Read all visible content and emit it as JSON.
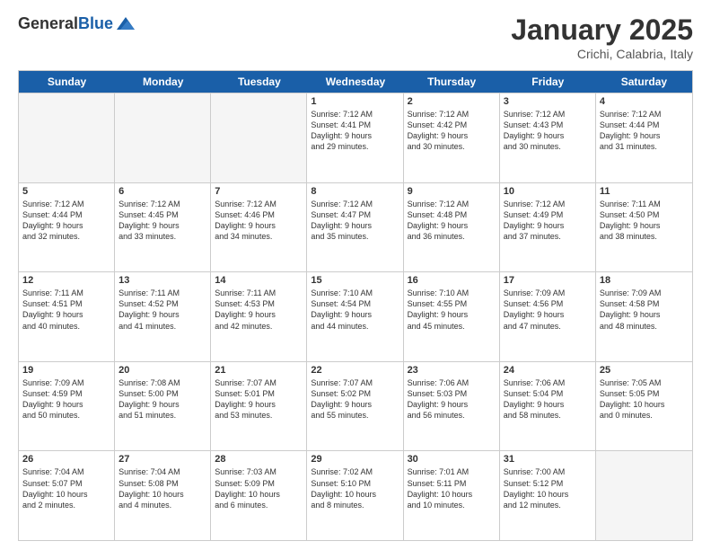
{
  "header": {
    "logo_general": "General",
    "logo_blue": "Blue",
    "month": "January 2025",
    "location": "Crichi, Calabria, Italy"
  },
  "weekdays": [
    "Sunday",
    "Monday",
    "Tuesday",
    "Wednesday",
    "Thursday",
    "Friday",
    "Saturday"
  ],
  "weeks": [
    [
      {
        "day": "",
        "empty": true
      },
      {
        "day": "",
        "empty": true
      },
      {
        "day": "",
        "empty": true
      },
      {
        "day": "1",
        "sunrise": "7:12 AM",
        "sunset": "4:41 PM",
        "daylight": "9 hours and 29 minutes."
      },
      {
        "day": "2",
        "sunrise": "7:12 AM",
        "sunset": "4:42 PM",
        "daylight": "9 hours and 30 minutes."
      },
      {
        "day": "3",
        "sunrise": "7:12 AM",
        "sunset": "4:43 PM",
        "daylight": "9 hours and 30 minutes."
      },
      {
        "day": "4",
        "sunrise": "7:12 AM",
        "sunset": "4:44 PM",
        "daylight": "9 hours and 31 minutes."
      }
    ],
    [
      {
        "day": "5",
        "sunrise": "7:12 AM",
        "sunset": "4:44 PM",
        "daylight": "9 hours and 32 minutes."
      },
      {
        "day": "6",
        "sunrise": "7:12 AM",
        "sunset": "4:45 PM",
        "daylight": "9 hours and 33 minutes."
      },
      {
        "day": "7",
        "sunrise": "7:12 AM",
        "sunset": "4:46 PM",
        "daylight": "9 hours and 34 minutes."
      },
      {
        "day": "8",
        "sunrise": "7:12 AM",
        "sunset": "4:47 PM",
        "daylight": "9 hours and 35 minutes."
      },
      {
        "day": "9",
        "sunrise": "7:12 AM",
        "sunset": "4:48 PM",
        "daylight": "9 hours and 36 minutes."
      },
      {
        "day": "10",
        "sunrise": "7:12 AM",
        "sunset": "4:49 PM",
        "daylight": "9 hours and 37 minutes."
      },
      {
        "day": "11",
        "sunrise": "7:11 AM",
        "sunset": "4:50 PM",
        "daylight": "9 hours and 38 minutes."
      }
    ],
    [
      {
        "day": "12",
        "sunrise": "7:11 AM",
        "sunset": "4:51 PM",
        "daylight": "9 hours and 40 minutes."
      },
      {
        "day": "13",
        "sunrise": "7:11 AM",
        "sunset": "4:52 PM",
        "daylight": "9 hours and 41 minutes."
      },
      {
        "day": "14",
        "sunrise": "7:11 AM",
        "sunset": "4:53 PM",
        "daylight": "9 hours and 42 minutes."
      },
      {
        "day": "15",
        "sunrise": "7:10 AM",
        "sunset": "4:54 PM",
        "daylight": "9 hours and 44 minutes."
      },
      {
        "day": "16",
        "sunrise": "7:10 AM",
        "sunset": "4:55 PM",
        "daylight": "9 hours and 45 minutes."
      },
      {
        "day": "17",
        "sunrise": "7:09 AM",
        "sunset": "4:56 PM",
        "daylight": "9 hours and 47 minutes."
      },
      {
        "day": "18",
        "sunrise": "7:09 AM",
        "sunset": "4:58 PM",
        "daylight": "9 hours and 48 minutes."
      }
    ],
    [
      {
        "day": "19",
        "sunrise": "7:09 AM",
        "sunset": "4:59 PM",
        "daylight": "9 hours and 50 minutes."
      },
      {
        "day": "20",
        "sunrise": "7:08 AM",
        "sunset": "5:00 PM",
        "daylight": "9 hours and 51 minutes."
      },
      {
        "day": "21",
        "sunrise": "7:07 AM",
        "sunset": "5:01 PM",
        "daylight": "9 hours and 53 minutes."
      },
      {
        "day": "22",
        "sunrise": "7:07 AM",
        "sunset": "5:02 PM",
        "daylight": "9 hours and 55 minutes."
      },
      {
        "day": "23",
        "sunrise": "7:06 AM",
        "sunset": "5:03 PM",
        "daylight": "9 hours and 56 minutes."
      },
      {
        "day": "24",
        "sunrise": "7:06 AM",
        "sunset": "5:04 PM",
        "daylight": "9 hours and 58 minutes."
      },
      {
        "day": "25",
        "sunrise": "7:05 AM",
        "sunset": "5:05 PM",
        "daylight": "10 hours and 0 minutes."
      }
    ],
    [
      {
        "day": "26",
        "sunrise": "7:04 AM",
        "sunset": "5:07 PM",
        "daylight": "10 hours and 2 minutes."
      },
      {
        "day": "27",
        "sunrise": "7:04 AM",
        "sunset": "5:08 PM",
        "daylight": "10 hours and 4 minutes."
      },
      {
        "day": "28",
        "sunrise": "7:03 AM",
        "sunset": "5:09 PM",
        "daylight": "10 hours and 6 minutes."
      },
      {
        "day": "29",
        "sunrise": "7:02 AM",
        "sunset": "5:10 PM",
        "daylight": "10 hours and 8 minutes."
      },
      {
        "day": "30",
        "sunrise": "7:01 AM",
        "sunset": "5:11 PM",
        "daylight": "10 hours and 10 minutes."
      },
      {
        "day": "31",
        "sunrise": "7:00 AM",
        "sunset": "5:12 PM",
        "daylight": "10 hours and 12 minutes."
      },
      {
        "day": "",
        "empty": true
      }
    ]
  ],
  "labels": {
    "sunrise": "Sunrise:",
    "sunset": "Sunset:",
    "daylight": "Daylight:"
  }
}
